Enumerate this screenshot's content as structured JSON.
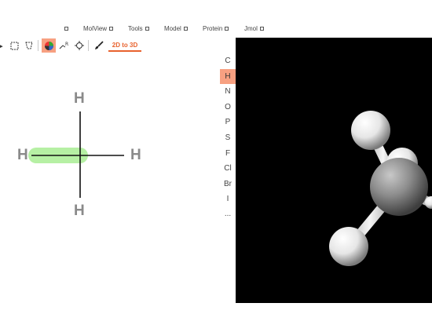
{
  "menu": {
    "items": [
      {
        "label": "MolView"
      },
      {
        "label": "Tools"
      },
      {
        "label": "Model"
      },
      {
        "label": "Protein"
      },
      {
        "label": "Jmol"
      }
    ]
  },
  "toolbar": {
    "tools": [
      "erase-tool",
      "rectangle-select-tool",
      "lasso-select-tool",
      "color-mode-tool",
      "fragment-tool",
      "center-tool",
      "clean-tool"
    ],
    "selected_tool": "color-mode-tool",
    "convert_label": "2D to 3D",
    "accent_color": "#e8622e",
    "selected_bg": "#f7a081"
  },
  "palette": {
    "elements": [
      "C",
      "H",
      "N",
      "O",
      "P",
      "S",
      "F",
      "Cl",
      "Br",
      "I",
      "..."
    ],
    "selected": "H"
  },
  "sketch": {
    "atoms": [
      "H",
      "H",
      "H",
      "H"
    ],
    "highlight_color": "#b6f0a4"
  },
  "viewer": {
    "background": "#000000",
    "atom_colors": {
      "carbon": "#909090",
      "hydrogen": "#ffffff"
    }
  }
}
